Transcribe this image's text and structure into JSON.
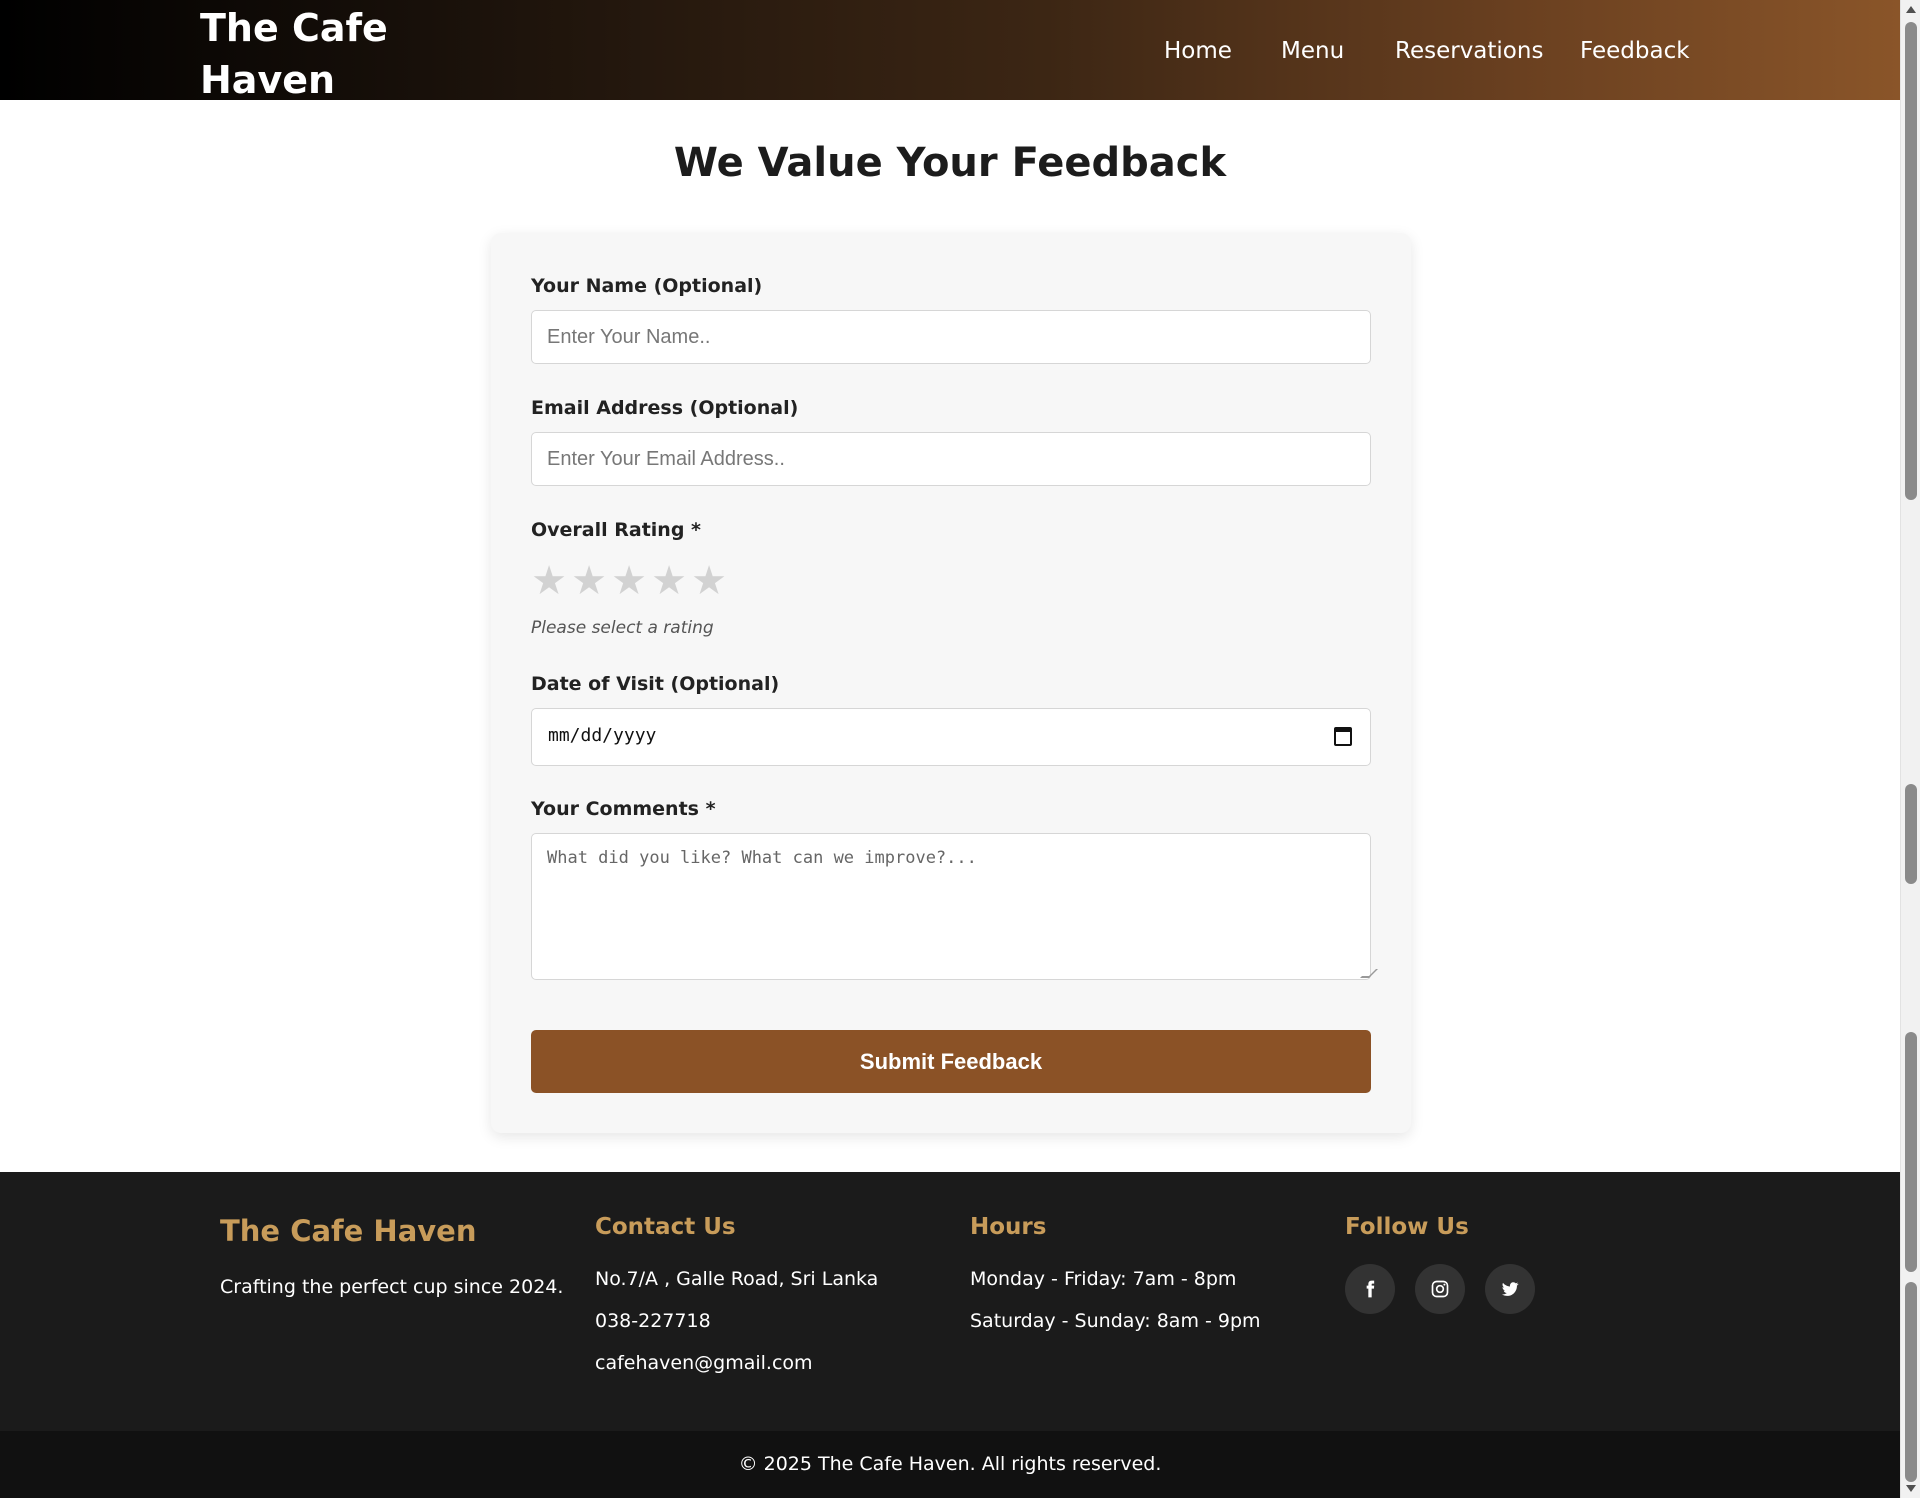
{
  "brand": {
    "name": "The Cafe Haven"
  },
  "nav": {
    "items": [
      "Home",
      "Menu",
      "Reservations",
      "Feedback"
    ]
  },
  "main": {
    "title": "We Value Your Feedback"
  },
  "form": {
    "name_label": "Your Name (Optional)",
    "name_placeholder": "Enter Your Name..",
    "email_label": "Email Address (Optional)",
    "email_placeholder": "Enter Your Email Address..",
    "rating_label": "Overall Rating *",
    "rating_value": 0,
    "rating_max": 5,
    "star_glyph": "★",
    "rating_hint": "Please select a rating",
    "date_label": "Date of Visit (Optional)",
    "date_placeholder": "mm/dd/yyyy",
    "comments_label": "Your Comments *",
    "comments_placeholder": "What did you like? What can we improve?...",
    "submit_label": "Submit Feedback"
  },
  "footer": {
    "brand": "The Cafe Haven",
    "tagline": "Crafting the perfect cup since 2024.",
    "contact": {
      "title": "Contact Us",
      "address": "No.7/A , Galle Road, Sri Lanka",
      "phone": "038-227718",
      "email": "cafehaven@gmail.com"
    },
    "hours": {
      "title": "Hours",
      "weekdays": "Monday - Friday: 7am - 8pm",
      "weekend": "Saturday - Sunday: 8am - 9pm"
    },
    "follow": {
      "title": "Follow Us",
      "icons": [
        "facebook-icon",
        "instagram-icon",
        "twitter-icon"
      ]
    },
    "copyright": "© 2025 The Cafe Haven. All rights reserved."
  },
  "colors": {
    "accent": "#8b5226",
    "footer_heading": "#c89c5a",
    "footer_bg": "#1b1b1b",
    "star_inactive": "#d2d2d2"
  }
}
